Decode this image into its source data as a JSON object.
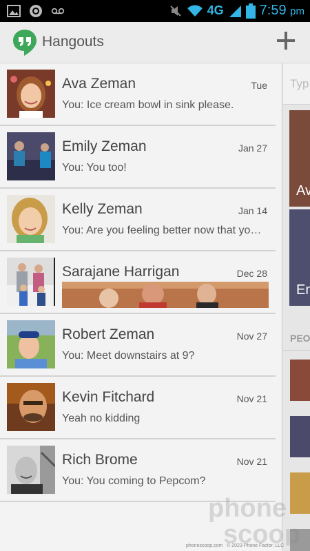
{
  "status_bar": {
    "network": "4G",
    "time": "7:59",
    "ampm": "pm"
  },
  "header": {
    "title": "Hangouts"
  },
  "conversations": [
    {
      "name": "Ava Zeman",
      "date": "Tue",
      "message": "You: Ice cream bowl in sink please."
    },
    {
      "name": "Emily Zeman",
      "date": "Jan 27",
      "message": "You: You too!"
    },
    {
      "name": "Kelly Zeman",
      "date": "Jan 14",
      "message": "You: Are you feeling better now that you're home?"
    },
    {
      "name": "Sarajane Harrigan",
      "date": "Dec 28",
      "message": ""
    },
    {
      "name": "Robert Zeman",
      "date": "Nov 27",
      "message": "You: Meet downstairs at 9?"
    },
    {
      "name": "Kevin Fitchard",
      "date": "Nov 21",
      "message": "Yeah no kidding"
    },
    {
      "name": "Rich Brome",
      "date": "Nov 21",
      "message": "You: You coming to Pepcom?"
    }
  ],
  "side_panel": {
    "search_placeholder": "Typ",
    "card1_label": "Av",
    "card2_label": "Em",
    "section_label": "PEO"
  },
  "watermark": {
    "line1": "phone",
    "line2": "scoop"
  },
  "footer": {
    "site": "phonescoop.com",
    "copyright": "© 2023 Phone Factor, LLC"
  }
}
